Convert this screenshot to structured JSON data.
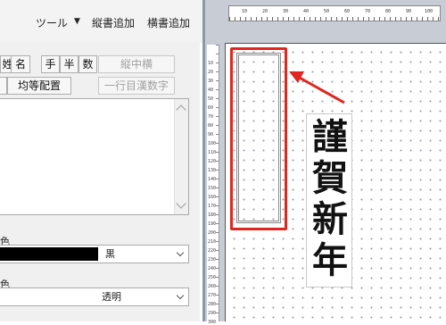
{
  "menu": {
    "tool": "ツール",
    "tool_arrow": "▼",
    "vertical_add": "縦書追加",
    "horizontal_add": "横書追加"
  },
  "panel": {
    "row1": [
      {
        "label": "姓",
        "enabled": true
      },
      {
        "label": "名",
        "enabled": true
      },
      {
        "label": "手",
        "enabled": true
      },
      {
        "label": "半",
        "enabled": true
      },
      {
        "label": "数",
        "enabled": true
      },
      {
        "label": "縦中横",
        "enabled": false
      }
    ],
    "row2": [
      {
        "label": "均等配置",
        "enabled": true
      },
      {
        "label": "一行目漢数字",
        "enabled": false
      }
    ],
    "text_color_label": "色",
    "text_color_value": "黒",
    "bg_color_label": "色",
    "bg_color_value": "透明"
  },
  "ruler": {
    "top": [
      "10",
      "20",
      "30",
      "40",
      "50",
      "60",
      "70",
      "80",
      "90",
      "100"
    ],
    "left": [
      "10",
      "20",
      "30",
      "40",
      "50",
      "60",
      "70",
      "80",
      "90",
      "100",
      "110",
      "120",
      "130",
      "140",
      "150",
      "160",
      "170",
      "180",
      "190",
      "200",
      "210",
      "220",
      "230",
      "240",
      "250",
      "260",
      "270",
      "280",
      "290",
      "300"
    ]
  },
  "sample": {
    "chars": [
      "謹",
      "賀",
      "新",
      "年"
    ]
  },
  "colors": {
    "highlight": "#e0261f",
    "panel_bg": "#f0f0f0",
    "canvas_bg": "#c8ccd4"
  }
}
